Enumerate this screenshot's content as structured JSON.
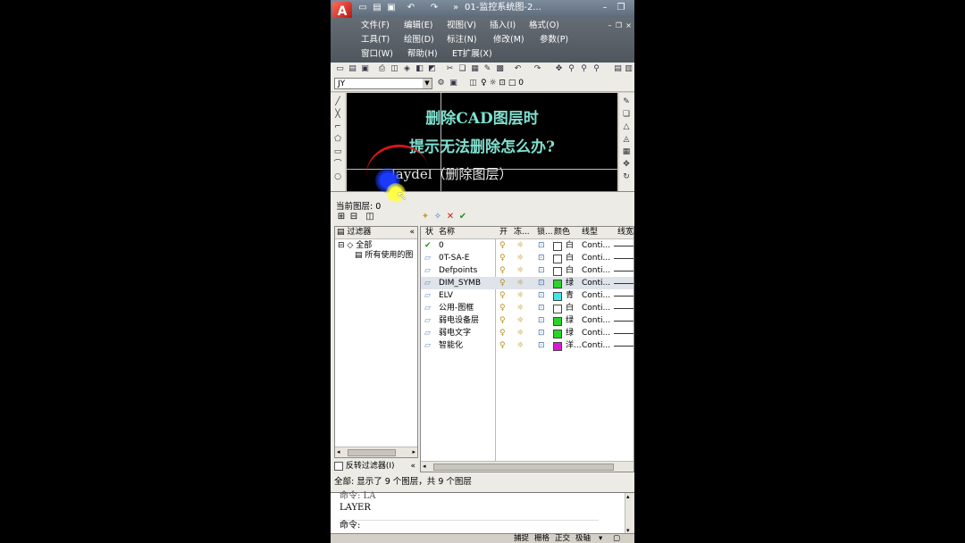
{
  "window": {
    "doc_tab": "01-监控系统图-2..."
  },
  "menu": {
    "row1": [
      "文件(F)",
      "编辑(E)",
      "视图(V)",
      "插入(I)",
      "格式(O)"
    ],
    "row2": [
      "工具(T)",
      "绘图(D)",
      "标注(N)",
      "修改(M)",
      "参数(P)"
    ],
    "row3": [
      "窗口(W)",
      "帮助(H)",
      "ET扩展(X)"
    ]
  },
  "layer_toolbar": {
    "combo_value": "JY",
    "current_layer_display": "0"
  },
  "canvas": {
    "caption_line1": "删除CAD图层时",
    "caption_line2": "提示无法删除怎么办?",
    "caption_line3": "laydel（删除图层）"
  },
  "layer_dialog": {
    "current_layer_label": "当前图层: 0",
    "filter_header": "过滤器",
    "tree_all": "全部",
    "tree_used": "所有使用的图",
    "invert_filter": "反转过滤器(I)",
    "columns": {
      "status": "状",
      "name": "名称",
      "on": "开",
      "freeze": "冻...",
      "lock": "锁...",
      "color": "颜色",
      "linetype": "线型",
      "lineweight": "线宽"
    },
    "layers": [
      {
        "name": "0",
        "color_name": "白",
        "color": "#ffffff",
        "linetype": "Conti...",
        "current": true
      },
      {
        "name": "0T-SA-E",
        "color_name": "白",
        "color": "#ffffff",
        "linetype": "Conti...",
        "current": false
      },
      {
        "name": "Defpoints",
        "color_name": "白",
        "color": "#ffffff",
        "linetype": "Conti...",
        "current": false
      },
      {
        "name": "DIM_SYMB",
        "color_name": "绿",
        "color": "#2bd42b",
        "linetype": "Conti...",
        "current": false
      },
      {
        "name": "ELV",
        "color_name": "青",
        "color": "#3ee8e8",
        "linetype": "Conti...",
        "current": false
      },
      {
        "name": "公用-图框",
        "color_name": "白",
        "color": "#ffffff",
        "linetype": "Conti...",
        "current": false
      },
      {
        "name": "弱电设备层",
        "color_name": "绿",
        "color": "#2bd42b",
        "linetype": "Conti...",
        "current": false
      },
      {
        "name": "弱电文字",
        "color_name": "绿",
        "color": "#2bd42b",
        "linetype": "Conti...",
        "current": false
      },
      {
        "name": "智能化",
        "color_name": "洋...",
        "color": "#d81ad8",
        "linetype": "Conti...",
        "current": false
      }
    ],
    "summary": "全部: 显示了 9 个图层，共 9 个图层"
  },
  "command": {
    "line1": "命令:  LA",
    "line2": "LAYER",
    "prompt": "命令:"
  },
  "statusbar": {
    "items": [
      "捕捉",
      "栅格",
      "正交",
      "极轴"
    ]
  }
}
